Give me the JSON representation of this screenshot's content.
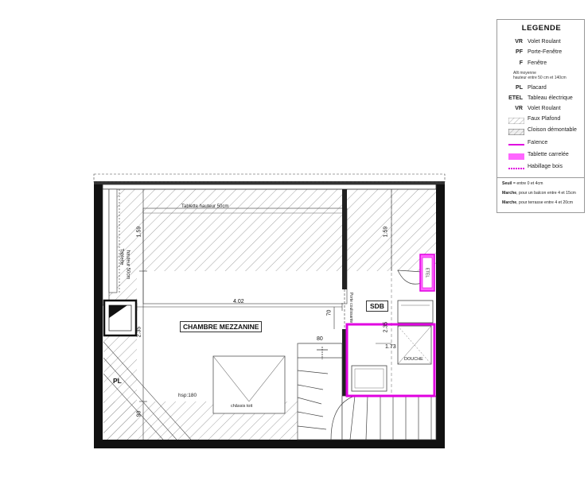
{
  "legend": {
    "title": "LEGENDE",
    "items": [
      {
        "code": "VR",
        "label": "Volet  Roulant"
      },
      {
        "code": "PF",
        "label": "Porte-Fenêtre"
      },
      {
        "code": "F",
        "label": "Fenêtre"
      },
      {
        "note1": "Allt moyenne",
        "note2": "hauteur entre 50 cm et 140cm"
      },
      {
        "code": "PL",
        "label": "Placard"
      },
      {
        "code": "ETEL",
        "label": "Tableau électrique"
      },
      {
        "code": "VR",
        "label": "Volet  Roulant"
      }
    ],
    "symbols": [
      {
        "name": "faux-plafond",
        "label": "Faux Plafond"
      },
      {
        "name": "cloison-demontable",
        "label": "Cloison démontable"
      },
      {
        "name": "faience",
        "label": "Faïence"
      },
      {
        "name": "tablette-carrelee",
        "label": "Tablette carrelée"
      },
      {
        "name": "habillage-bois",
        "label": "Habillage bois"
      }
    ],
    "notes": [
      {
        "bold": "Seuil",
        "text": " = entre 0 et 4cm"
      },
      {
        "bold": "Marche",
        "text": ", pour un balcon entre 4 et 15cm"
      },
      {
        "bold": "Marche",
        "text": ", pour terrasse entre 4 et 20cm"
      }
    ]
  },
  "colors": {
    "wall": "#111111",
    "hatch": "#888888",
    "faience": "#e000e0",
    "tablette": "#ff66ff"
  },
  "plan": {
    "room_main": "CHAMBRE  MEZZANINE",
    "room_sdb": "SDB",
    "closet": "PL",
    "tablette_top": "Tablette hauteur 50cm",
    "tablette_left": "Tablette",
    "tablette_left2": "hauteur 50cm",
    "dim_402": "4.02",
    "dim_159a": "1.59",
    "dim_159b": "1.59",
    "dim_235a": "2.35",
    "dim_235b": "2.35",
    "dim_70": "70",
    "dim_80": "80",
    "dim_90": "90",
    "dim_173": "1.73",
    "hsp": "hsp:180",
    "chassis": "châssis toit",
    "douche": "DOUCHE",
    "porte": "Porte coulissante",
    "etel": "ETEL"
  }
}
